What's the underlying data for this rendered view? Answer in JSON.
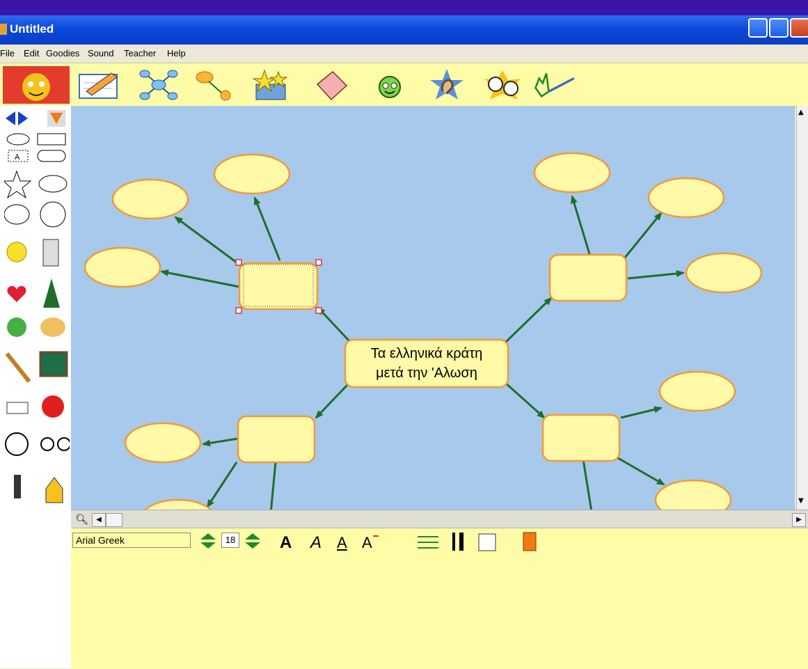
{
  "window": {
    "title": "Untitled"
  },
  "menu": [
    "File",
    "Edit",
    "Goodies",
    "Sound",
    "Teacher",
    "Help"
  ],
  "toolbar": [
    {
      "id": "picture-to-note",
      "icon": "pencil-notepad-icon"
    },
    {
      "id": "create-map",
      "icon": "map-link-icon"
    },
    {
      "id": "link",
      "icon": "link-arrow-icon"
    },
    {
      "id": "goodies",
      "icon": "star-box-icon"
    },
    {
      "id": "eraser",
      "icon": "eraser-icon"
    },
    {
      "id": "surprise",
      "icon": "smiley-icon"
    },
    {
      "id": "listen",
      "icon": "ear-icon"
    },
    {
      "id": "speak",
      "icon": "faces-icon"
    },
    {
      "id": "paint",
      "icon": "paintbrush-icon"
    }
  ],
  "canvas": {
    "central_topic": [
      "Τα ελληνικά κράτη",
      "μετά την 'Αλωση"
    ],
    "colors": {
      "background": "#a7c9ec",
      "node_fill": "#fff9a8",
      "node_border": "#f09a3a",
      "arrow": "#1f6e2a"
    }
  },
  "format": {
    "font": "Arial Greek",
    "size": "18"
  }
}
